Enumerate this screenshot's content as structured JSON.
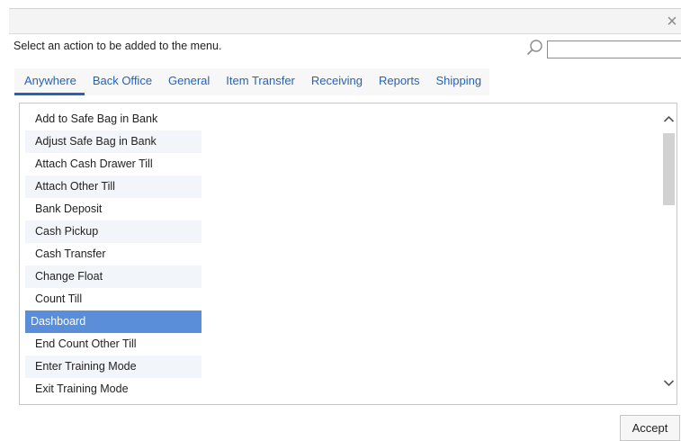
{
  "dialog": {
    "close_symbol": "×",
    "instruction": "Select an action to be added to the menu.",
    "search": {
      "value": "",
      "placeholder": ""
    },
    "accept_label": "Accept"
  },
  "tabs": [
    {
      "label": "Anywhere",
      "active": true
    },
    {
      "label": "Back Office",
      "active": false
    },
    {
      "label": "General",
      "active": false
    },
    {
      "label": "Item Transfer",
      "active": false
    },
    {
      "label": "Receiving",
      "active": false
    },
    {
      "label": "Reports",
      "active": false
    },
    {
      "label": "Shipping",
      "active": false
    }
  ],
  "actions": [
    {
      "label": "Add to Safe Bag in Bank",
      "selected": false
    },
    {
      "label": "Adjust Safe Bag in Bank",
      "selected": false
    },
    {
      "label": "Attach Cash Drawer Till",
      "selected": false
    },
    {
      "label": "Attach Other Till",
      "selected": false
    },
    {
      "label": "Bank Deposit",
      "selected": false
    },
    {
      "label": "Cash Pickup",
      "selected": false
    },
    {
      "label": "Cash Transfer",
      "selected": false
    },
    {
      "label": "Change Float",
      "selected": false
    },
    {
      "label": "Count Till",
      "selected": false
    },
    {
      "label": "Dashboard",
      "selected": true
    },
    {
      "label": "End Count Other Till",
      "selected": false
    },
    {
      "label": "Enter Training Mode",
      "selected": false
    },
    {
      "label": "Exit Training Mode",
      "selected": false
    }
  ],
  "colors": {
    "accent": "#2563b6",
    "selected_row": "#5b8ed8",
    "alt_row": "#f2f5fa",
    "header_bar": "#f4f4f4"
  },
  "icons": {
    "close": "close-icon",
    "search": "search-icon",
    "scroll_up": "chevron-up-icon",
    "scroll_down": "chevron-down-icon"
  }
}
